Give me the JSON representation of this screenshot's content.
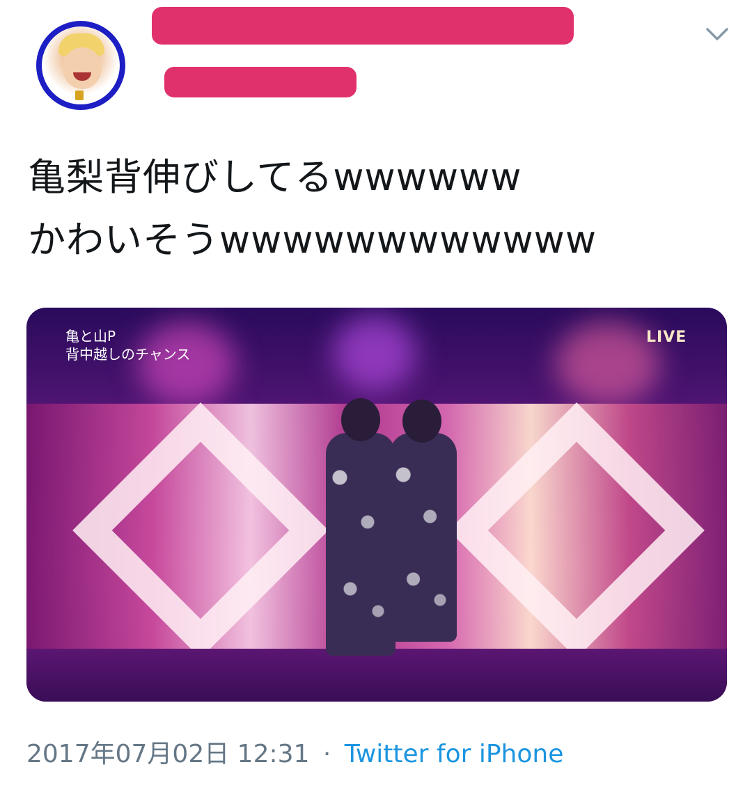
{
  "tweet": {
    "avatar_icon": "avatar-icon",
    "text_lines": [
      "亀梨背伸びしてるwwwwww",
      "かわいそうwwwwwwwwwwww"
    ],
    "more_icon": "chevron-down-icon"
  },
  "media": {
    "caption_line1": "亀と山P",
    "caption_line2": "背中越しのチャンス",
    "live_label": "LIVE"
  },
  "footer": {
    "date": "2017年07月02日 12:31",
    "separator": "·",
    "source": "Twitter for iPhone"
  },
  "colors": {
    "redaction": "#e0316c",
    "link": "#1b95e0",
    "meta": "#657786",
    "avatar_ring": "#1d1fc4"
  }
}
